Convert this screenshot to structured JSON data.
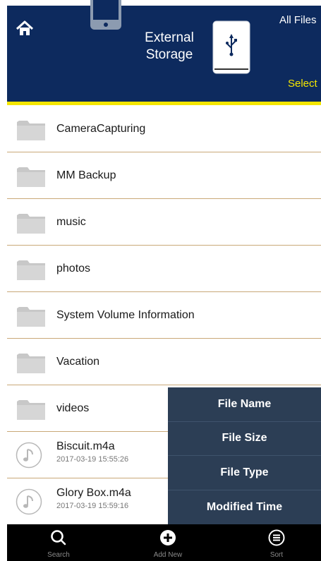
{
  "header": {
    "title_line1": "External",
    "title_line2": "Storage",
    "all_files": "All Files",
    "select": "Select",
    "icons": [
      "home-icon",
      "device-icon",
      "usb-drive-icon"
    ]
  },
  "files": [
    {
      "name": "CameraCapturing",
      "type": "folder"
    },
    {
      "name": "MM Backup",
      "type": "folder"
    },
    {
      "name": "music",
      "type": "folder"
    },
    {
      "name": "photos",
      "type": "folder"
    },
    {
      "name": "System Volume Information",
      "type": "folder"
    },
    {
      "name": "Vacation",
      "type": "folder"
    },
    {
      "name": "videos",
      "type": "folder"
    },
    {
      "name": "Biscuit.m4a",
      "type": "audio",
      "date": "2017-03-19 15:55:26"
    },
    {
      "name": "Glory Box.m4a",
      "type": "audio",
      "date": "2017-03-19 15:59:16"
    }
  ],
  "sort_menu": {
    "options": [
      "File Name",
      "File Size",
      "File Type",
      "Modified Time"
    ]
  },
  "tabbar": {
    "search": "Search",
    "add_new": "Add New",
    "sort": "Sort"
  },
  "colors": {
    "header_bg": "#0d2a5e",
    "accent_yellow": "#f4e600",
    "row_divider": "#c9a878",
    "sort_menu_bg": "#2c3e55",
    "tabbar_bg": "#000000"
  }
}
